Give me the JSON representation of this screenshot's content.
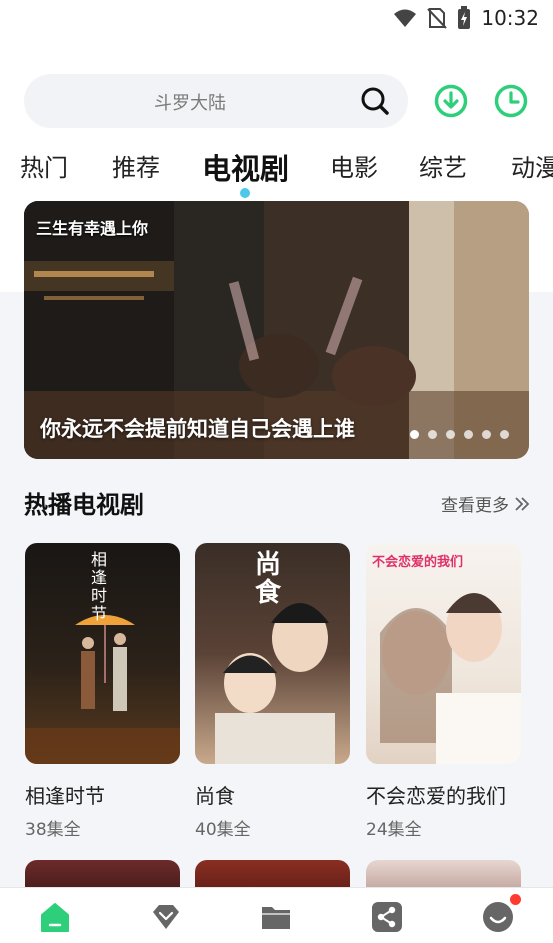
{
  "status_bar": {
    "time": "10:32"
  },
  "search": {
    "placeholder": "斗罗大陆"
  },
  "tabs": [
    {
      "label": "热门"
    },
    {
      "label": "推荐"
    },
    {
      "label": "电视剧",
      "active": true
    },
    {
      "label": "电影"
    },
    {
      "label": "综艺"
    },
    {
      "label": "动漫"
    }
  ],
  "banner": {
    "caption": "你永远不会提前知道自己会遇上谁",
    "logo_text": "三生有幸遇上你",
    "slides": 6,
    "active_slide": 1
  },
  "section": {
    "title": "热播电视剧",
    "see_more": "查看更多"
  },
  "shows": [
    {
      "title": "相逢时节",
      "episodes": "38集全",
      "poster_text": "相逢时节"
    },
    {
      "title": "尚食",
      "episodes": "40集全",
      "poster_text": "尚食"
    },
    {
      "title": "不会恋爱的我们",
      "episodes": "24集全",
      "poster_text": "不会恋爱的我们"
    }
  ],
  "colors": {
    "accent": "#2ecf7a",
    "tab_indicator": "#4cc9e8",
    "badge": "#ff3b30"
  },
  "nav_icons": [
    "home-icon",
    "diamond-icon",
    "folder-icon",
    "share-icon",
    "profile-icon"
  ]
}
